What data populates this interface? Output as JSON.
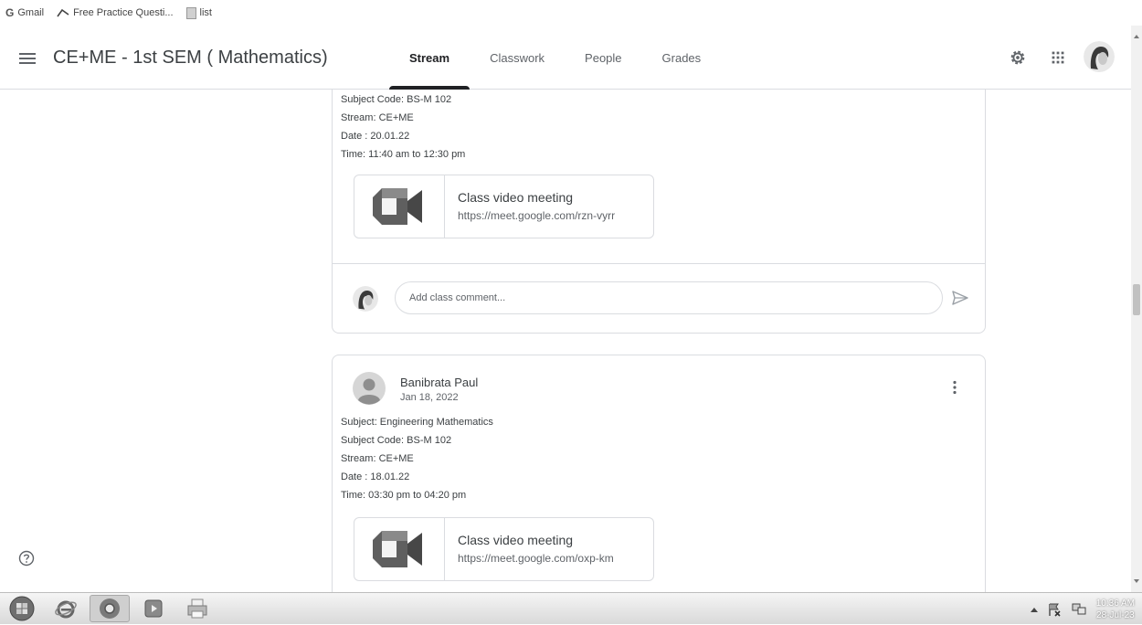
{
  "bookmarks": [
    {
      "label": "Gmail",
      "icon": "google-g-icon"
    },
    {
      "label": "Free Practice Questi...",
      "icon": "bookmark-logo-icon"
    },
    {
      "label": "list",
      "icon": "document-icon"
    }
  ],
  "header": {
    "class_title": "CE+ME - 1st SEM ( Mathematics)",
    "tabs": [
      {
        "label": "Stream",
        "active": true
      },
      {
        "label": "Classwork"
      },
      {
        "label": "People"
      },
      {
        "label": "Grades"
      }
    ]
  },
  "posts": [
    {
      "lines": [
        "Subject Code: BS-M 102",
        "Stream: CE+ME",
        "Date : 20.01.22",
        "Time: 11:40 am to 12:30 pm"
      ],
      "attachment": {
        "title": "Class video meeting",
        "url": "https://meet.google.com/rzn-vyrr"
      },
      "comment_placeholder": "Add class comment..."
    },
    {
      "author": "Banibrata Paul",
      "date": "Jan 18, 2022",
      "lines": [
        "Subject: Engineering Mathematics",
        "Subject Code: BS-M 102",
        "Stream: CE+ME",
        "Date : 18.01.22",
        "Time: 03:30 pm to 04:20 pm"
      ],
      "attachment": {
        "title": "Class video meeting",
        "url": "https://meet.google.com/oxp-km"
      }
    }
  ],
  "taskbar": {
    "time": "10:36 AM",
    "date": "28-Jul-23"
  },
  "colors": {
    "active_tab_underline": "#202124",
    "meet_icon_gray": "#5f5f5f"
  }
}
